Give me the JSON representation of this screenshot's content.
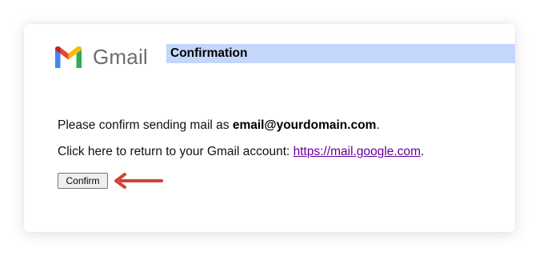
{
  "logo": {
    "icon": "gmail-m-icon",
    "text": "Gmail"
  },
  "header": {
    "title": "Confirmation"
  },
  "message": {
    "line1_prefix": "Please confirm sending mail as ",
    "email": "email@yourdomain.com",
    "line1_suffix": ".",
    "line2_prefix": "Click here to return to your Gmail account: ",
    "link_text": "https://mail.google.com",
    "line2_suffix": "."
  },
  "confirm_button": {
    "label": "Confirm"
  },
  "annotation": {
    "icon": "red-arrow-left-icon",
    "color": "#d14334"
  },
  "colors": {
    "header_bar": "#c4d6fb",
    "link": "#660099"
  }
}
